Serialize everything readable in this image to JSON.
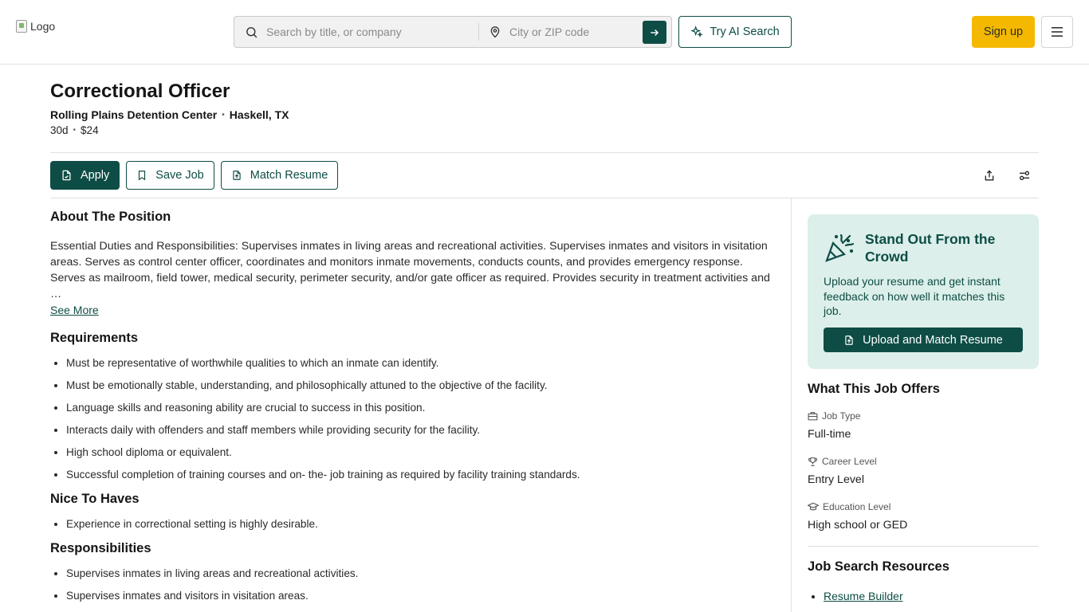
{
  "header": {
    "logo_alt": "Logo",
    "search_placeholder": "Search by title, or company",
    "location_placeholder": "City or ZIP code",
    "try_ai_label": "Try AI Search",
    "signup_label": "Sign up"
  },
  "job": {
    "title": "Correctional Officer",
    "company": "Rolling Plains Detention Center",
    "location": "Haskell, TX",
    "posted": "30d",
    "pay": "$24"
  },
  "actions": {
    "apply": "Apply",
    "save": "Save Job",
    "match": "Match Resume"
  },
  "about": {
    "heading": "About The Position",
    "text": "Essential Duties and Responsibilities: Supervises inmates in living areas and recreational activities. Supervises inmates and visitors in visitation areas. Serves as control center officer, coordinates and monitors inmate movements, conducts counts, and provides emergency response. Serves as mailroom, field tower, medical security, perimeter security, and/or gate officer as required. Provides security in treatment activities and …",
    "see_more": "See More"
  },
  "requirements": {
    "heading": "Requirements",
    "items": [
      "Must be representative of worthwhile qualities to which an inmate can identify.",
      "Must be emotionally stable, understanding, and philosophically attuned to the objective of the facility.",
      "Language skills and reasoning ability are crucial to success in this position.",
      "Interacts daily with offenders and staff members while providing security for the facility.",
      "High school diploma or equivalent.",
      "Successful completion of training courses and on- the- job training as required by facility training standards."
    ]
  },
  "nice": {
    "heading": "Nice To Haves",
    "items": [
      "Experience in correctional setting is highly desirable."
    ]
  },
  "responsibilities": {
    "heading": "Responsibilities",
    "items": [
      "Supervises inmates in living areas and recreational activities.",
      "Supervises inmates and visitors in visitation areas."
    ]
  },
  "promo": {
    "title": "Stand Out From the Crowd",
    "text": "Upload your resume and get instant feedback on how well it matches this job.",
    "button": "Upload and Match Resume"
  },
  "offers": {
    "heading": "What This Job Offers",
    "job_type_label": "Job Type",
    "job_type_value": "Full-time",
    "career_label": "Career Level",
    "career_value": "Entry Level",
    "education_label": "Education Level",
    "education_value": "High school or GED"
  },
  "resources": {
    "heading": "Job Search Resources",
    "items": [
      "Resume Builder"
    ]
  },
  "colors": {
    "brand": "#0e4d45",
    "accent": "#f5b800",
    "promo_bg": "#dcefea"
  }
}
